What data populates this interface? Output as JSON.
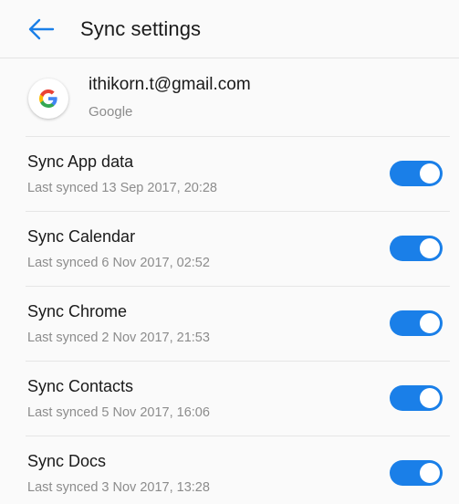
{
  "appbar": {
    "title": "Sync settings",
    "back_icon": "arrow-left-icon",
    "accent_color": "#1a7fe8"
  },
  "account": {
    "email": "ithikorn.t@gmail.com",
    "type": "Google",
    "avatar_icon": "google-g-icon"
  },
  "sync_items": [
    {
      "label": "Sync App data",
      "last_synced": "Last synced 13 Sep 2017, 20:28",
      "enabled": true
    },
    {
      "label": "Sync Calendar",
      "last_synced": "Last synced 6 Nov 2017, 02:52",
      "enabled": true
    },
    {
      "label": "Sync Chrome",
      "last_synced": "Last synced 2 Nov 2017, 21:53",
      "enabled": true
    },
    {
      "label": "Sync Contacts",
      "last_synced": "Last synced 5 Nov 2017, 16:06",
      "enabled": true
    },
    {
      "label": "Sync Docs",
      "last_synced": "Last synced 3 Nov 2017, 13:28",
      "enabled": true
    }
  ]
}
